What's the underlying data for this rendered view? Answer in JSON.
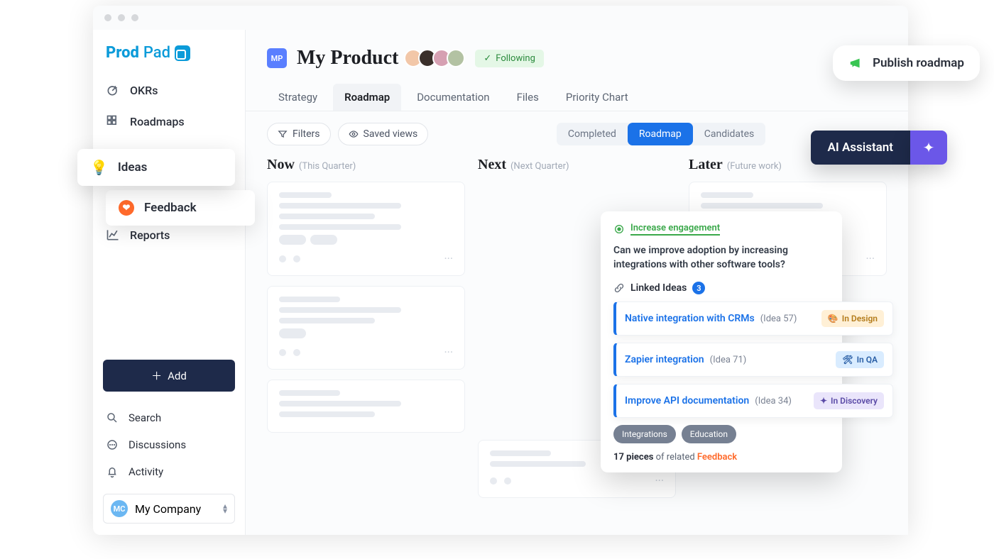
{
  "logo": {
    "text1": "Prod",
    "text2": "Pad"
  },
  "nav": {
    "okrs": "OKRs",
    "roadmaps": "Roadmaps",
    "ideas": "Ideas",
    "feedback": "Feedback",
    "reports": "Reports"
  },
  "sidebar_actions": {
    "add": "Add",
    "search": "Search",
    "discussions": "Discussions",
    "activity": "Activity"
  },
  "company": {
    "badge": "MC",
    "name": "My Company"
  },
  "product": {
    "badge": "MP",
    "title": "My Product"
  },
  "following": "Following",
  "tabs": {
    "strategy": "Strategy",
    "roadmap": "Roadmap",
    "documentation": "Documentation",
    "files": "Files",
    "priority": "Priority Chart"
  },
  "controls": {
    "filters": "Filters",
    "saved_views": "Saved views",
    "segments": {
      "completed": "Completed",
      "roadmap": "Roadmap",
      "candidates": "Candidates"
    }
  },
  "columns": {
    "now": {
      "title": "Now",
      "sub": "(This Quarter)"
    },
    "next": {
      "title": "Next",
      "sub": "(Next Quarter)"
    },
    "later": {
      "title": "Later",
      "sub": "(Future work)"
    }
  },
  "popover": {
    "objective": "Increase engagement",
    "question": "Can we improve adoption by increasing integrations with other software tools?",
    "linked_label": "Linked Ideas",
    "linked_count": "3",
    "ideas": [
      {
        "title": "Native integration with CRMs",
        "id": "(Idea 57)",
        "status": "In Design"
      },
      {
        "title": "Zapier integration",
        "id": "(Idea 71)",
        "status": "In QA"
      },
      {
        "title": "Improve API documentation",
        "id": "(Idea 34)",
        "status": "In Discovery"
      }
    ],
    "tags": [
      "Integrations",
      "Education"
    ],
    "feedback_count": "17 pieces",
    "feedback_mid": " of related ",
    "feedback_word": "Feedback"
  },
  "floats": {
    "publish": "Publish roadmap",
    "ai": "AI Assistant"
  }
}
